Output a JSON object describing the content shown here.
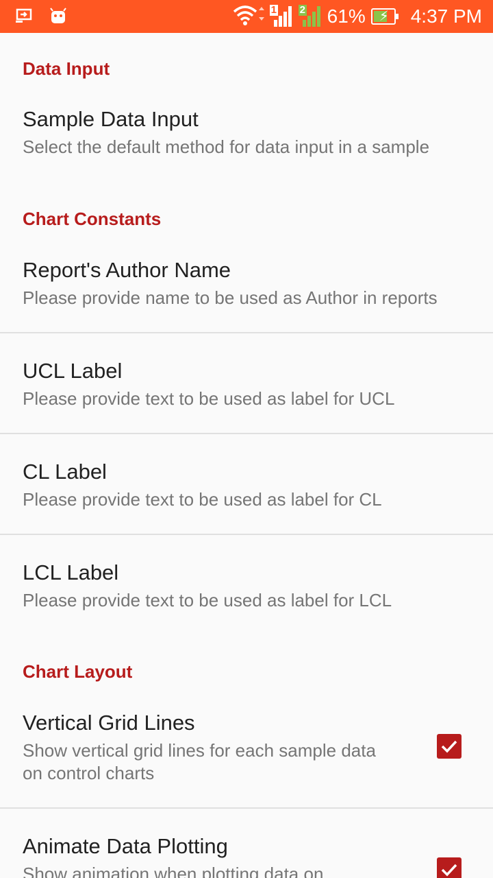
{
  "status_bar": {
    "battery_percent": "61%",
    "time": "4:37 PM",
    "sim1_label": "1",
    "sim2_label": "2",
    "icons": [
      "screen-cast-icon",
      "android-icon",
      "wifi-icon",
      "signal-sim1-icon",
      "signal-sim2-icon",
      "battery-charging-icon"
    ],
    "color": "#ff5722"
  },
  "sections": {
    "data_input": {
      "header": "Data Input",
      "sample_data_input": {
        "title": "Sample Data Input",
        "summary": "Select the default method for data input in a sample"
      }
    },
    "chart_constants": {
      "header": "Chart Constants",
      "author_name": {
        "title": "Report's Author Name",
        "summary": "Please provide name to be used as Author in reports"
      },
      "ucl_label": {
        "title": "UCL Label",
        "summary": "Please provide text to be used as label for UCL"
      },
      "cl_label": {
        "title": "CL Label",
        "summary": "Please provide text to be used as label for CL"
      },
      "lcl_label": {
        "title": "LCL Label",
        "summary": "Please provide text to be used as label for LCL"
      }
    },
    "chart_layout": {
      "header": "Chart Layout",
      "vertical_grid_lines": {
        "title": "Vertical Grid Lines",
        "summary_line1": "Show vertical grid lines for each sample data",
        "summary_line2": "on control charts",
        "checked": true
      },
      "animate_data_plotting": {
        "title": "Animate Data Plotting",
        "summary_line1": "Show animation when plotting data on",
        "checked": true
      }
    }
  },
  "colors": {
    "accent": "#b71c1c",
    "background": "#fafafa"
  }
}
